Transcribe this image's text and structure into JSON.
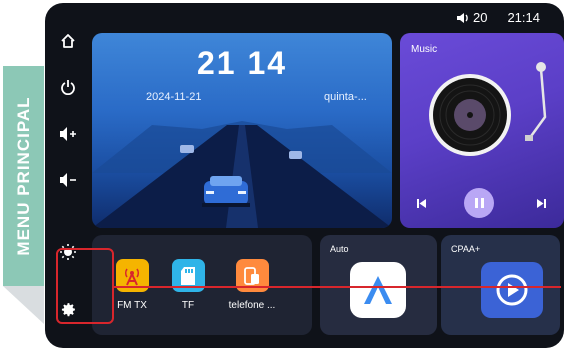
{
  "banner": {
    "text": "MENU PRINCIPAL"
  },
  "status": {
    "volume_icon": "speaker-icon",
    "volume": "20",
    "time": "21:14"
  },
  "sidebar": {
    "items": [
      {
        "name": "home",
        "icon": "home-icon"
      },
      {
        "name": "power",
        "icon": "power-icon"
      },
      {
        "name": "volume-up",
        "icon": "volume-up-icon"
      },
      {
        "name": "volume-down",
        "icon": "volume-down-icon"
      },
      {
        "name": "brightness",
        "icon": "brightness-icon"
      },
      {
        "name": "settings",
        "icon": "gear-icon"
      }
    ]
  },
  "clock": {
    "time": "21 14",
    "date": "2024-11-21",
    "day": "quinta-..."
  },
  "music": {
    "title": "Music",
    "prev_icon": "skip-previous-icon",
    "play_icon": "pause-icon",
    "next_icon": "skip-next-icon"
  },
  "apps": [
    {
      "label": "FM TX",
      "icon": "antenna-icon",
      "color": "#f5b400"
    },
    {
      "label": "TF",
      "icon": "sd-card-icon",
      "color": "#2fb4e8"
    },
    {
      "label": "telefone ...",
      "icon": "phone-mirror-icon",
      "color": "#ff8a3d"
    }
  ],
  "tiles": {
    "auto": {
      "title": "Auto",
      "icon": "android-auto-icon"
    },
    "carplay": {
      "title": "CPAA+",
      "icon": "carplay-icon"
    }
  },
  "colors": {
    "highlight": "#d8262c",
    "banner": "#8cc8b6",
    "screen_bg": "#0f1219"
  }
}
